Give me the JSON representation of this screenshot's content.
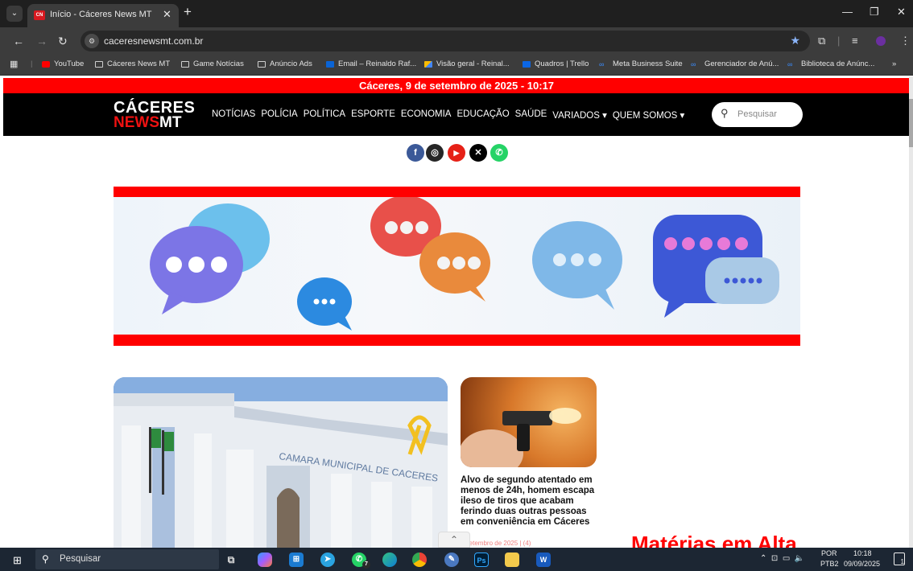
{
  "browser": {
    "tab_title": "Início - Cáceres News MT",
    "favicon_text": "CN",
    "url": "caceresnewsmt.com.br",
    "bookmarks": [
      {
        "label": "YouTube",
        "icon": "youtube-icon"
      },
      {
        "label": "Cáceres News MT",
        "icon": "folder-icon"
      },
      {
        "label": "Game Notícias",
        "icon": "folder-icon"
      },
      {
        "label": "Anúncio Ads",
        "icon": "folder-icon"
      },
      {
        "label": "Email – Reinaldo Raf...",
        "icon": "outlook-icon"
      },
      {
        "label": "Visão geral - Reinal...",
        "icon": "google-ads-icon"
      },
      {
        "label": "Quadros | Trello",
        "icon": "trello-icon"
      },
      {
        "label": "Meta Business Suite",
        "icon": "meta-icon"
      },
      {
        "label": "Gerenciador de Anú...",
        "icon": "meta-icon"
      },
      {
        "label": "Biblioteca de Anúnc...",
        "icon": "meta-icon"
      }
    ],
    "more_bookmarks": "»"
  },
  "site": {
    "date_bar": "Cáceres, 9 de setembro de 2025 - 10:17",
    "logo_top": "CÁCERES",
    "logo_news": "NEWS",
    "logo_mt": "MT",
    "nav": [
      "NOTÍCIAS",
      "POLÍCIA",
      "POLÍTICA",
      "ESPORTE",
      "ECONOMIA",
      "EDUCAÇÃO",
      "SAÚDE",
      "VARIADOS ▾",
      "QUEM SOMOS ▾"
    ],
    "search_placeholder": "Pesquisar",
    "social": [
      {
        "name": "facebook-icon",
        "color": "#3b5998",
        "glyph": "f"
      },
      {
        "name": "instagram-icon",
        "color": "#262626",
        "glyph": "◎"
      },
      {
        "name": "youtube-icon",
        "color": "#e62117",
        "glyph": "▶"
      },
      {
        "name": "x-icon",
        "color": "#000000",
        "glyph": "𝕏"
      },
      {
        "name": "whatsapp-icon",
        "color": "#25d366",
        "glyph": "✆"
      }
    ],
    "feature_building_sign": "CAMARA MUNICIPAL DE CACERES",
    "headline": "Alvo de segundo atentado em menos de 24h, homem escapa ileso de tiros que acabam ferindo duas outras pessoas em conveniência em Cáceres",
    "meta": "9 setembro de 2025 | (4)",
    "section_title": "Matérias em Alta",
    "accent_color": "#ff0000"
  },
  "taskbar": {
    "search_text": "Pesquisar",
    "lang_1": "POR",
    "lang_2": "PTB2",
    "time": "10:18",
    "date": "09/09/2025",
    "notification_count": "1",
    "whatsapp_badge": "7"
  }
}
